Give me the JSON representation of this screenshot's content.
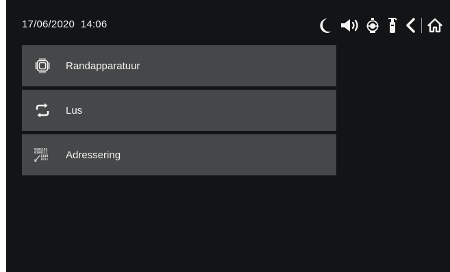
{
  "status": {
    "date": "17/06/2020",
    "time": "14:06",
    "icons": [
      "moon-icon",
      "speaker-icon",
      "alarm-bell-icon",
      "fire-extinguisher-icon",
      "back-icon",
      "home-icon"
    ]
  },
  "menu": {
    "items": [
      {
        "label": "Randapparatuur",
        "icon": "chip-icon"
      },
      {
        "label": "Lus",
        "icon": "loop-icon"
      },
      {
        "label": "Adressering",
        "icon": "binary-address-icon"
      }
    ]
  },
  "colors": {
    "background": "#131416",
    "item": "#464748",
    "text": "#f2f2f2"
  }
}
